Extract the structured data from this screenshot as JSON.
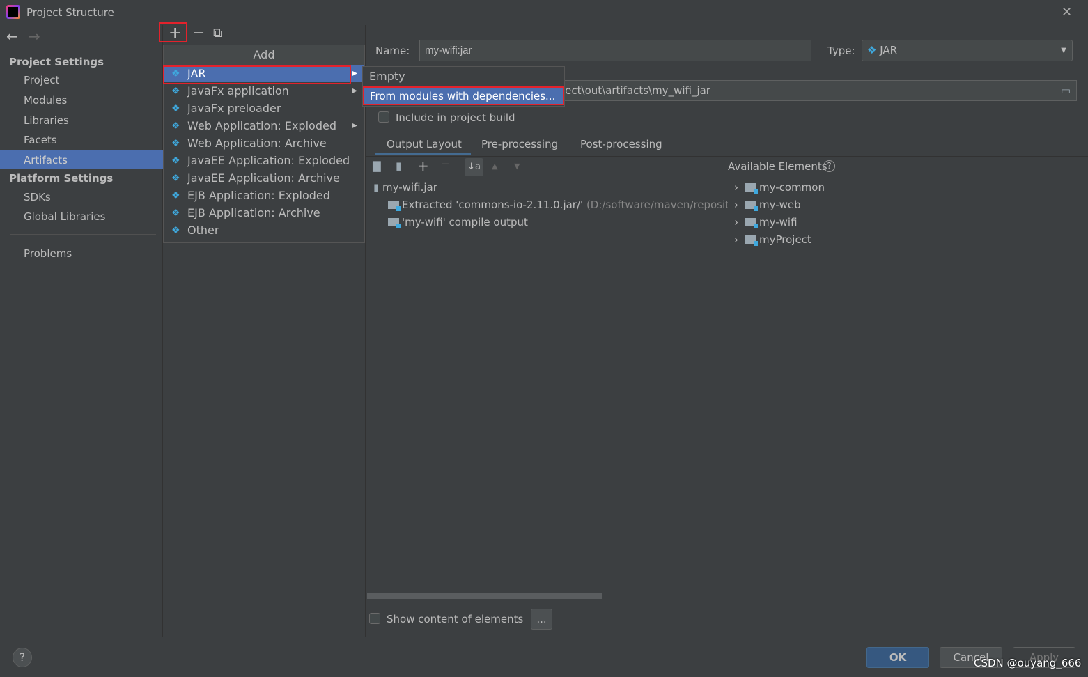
{
  "window": {
    "title": "Project Structure",
    "close": "✕"
  },
  "nav": {
    "back": "←",
    "forward": "→"
  },
  "toolbar": {
    "add": "+",
    "remove": "−",
    "copy": "⧉"
  },
  "sidebar": {
    "project_settings": "Project Settings",
    "items": [
      "Project",
      "Modules",
      "Libraries",
      "Facets",
      "Artifacts"
    ],
    "platform_settings": "Platform Settings",
    "platform_items": [
      "SDKs",
      "Global Libraries"
    ],
    "problems": "Problems",
    "selected": "Artifacts"
  },
  "add_menu": {
    "title": "Add",
    "items": [
      {
        "label": "JAR",
        "submenu": true,
        "icon": "jar-diamond-icon"
      },
      {
        "label": "JavaFx application",
        "submenu": true,
        "icon": "javafx-icon"
      },
      {
        "label": "JavaFx preloader",
        "submenu": false,
        "icon": "javafx-icon"
      },
      {
        "label": "Web Application: Exploded",
        "submenu": true,
        "icon": "web-icon"
      },
      {
        "label": "Web Application: Archive",
        "submenu": false,
        "icon": "web-icon"
      },
      {
        "label": "JavaEE Application: Exploded",
        "submenu": false,
        "icon": "javaee-icon"
      },
      {
        "label": "JavaEE Application: Archive",
        "submenu": false,
        "icon": "javaee-icon"
      },
      {
        "label": "EJB Application: Exploded",
        "submenu": false,
        "icon": "ejb-icon"
      },
      {
        "label": "EJB Application: Archive",
        "submenu": false,
        "icon": "ejb-icon"
      },
      {
        "label": "Other",
        "submenu": false,
        "icon": "other-icon"
      }
    ]
  },
  "jar_submenu": {
    "items": [
      "Empty",
      "From modules with dependencies..."
    ],
    "highlighted": "From modules with dependencies..."
  },
  "form": {
    "name_label": "Name:",
    "name_value": "my-wifi:jar",
    "type_label": "Type:",
    "type_value": "JAR",
    "output_dir": "ject\\out\\artifacts\\my_wifi_jar",
    "include_label": "Include in project build",
    "include_checked": false
  },
  "tabs": [
    "Output Layout",
    "Pre-processing",
    "Post-processing"
  ],
  "active_tab": "Output Layout",
  "layout_tree": [
    {
      "label": "my-wifi.jar",
      "extra": ""
    },
    {
      "label": "Extracted 'commons-io-2.11.0.jar/'",
      "extra": "(D:/software/maven/reposito"
    },
    {
      "label": "'my-wifi' compile output",
      "extra": ""
    }
  ],
  "available": {
    "title": "Available Elements",
    "help": "?",
    "items": [
      "my-common",
      "my-web",
      "my-wifi",
      "myProject"
    ]
  },
  "bottom": {
    "show_content": "Show content of elements",
    "more": "...",
    "show_checked": false
  },
  "footer": {
    "help": "?",
    "ok": "OK",
    "cancel": "Cancel",
    "apply": "Apply",
    "watermark": "CSDN @ouyang_666"
  },
  "colors": {
    "background": "#3c3f41",
    "selection": "#4b6eaf",
    "highlight_border": "#e3222c",
    "accent_icon": "#3fa9de"
  }
}
